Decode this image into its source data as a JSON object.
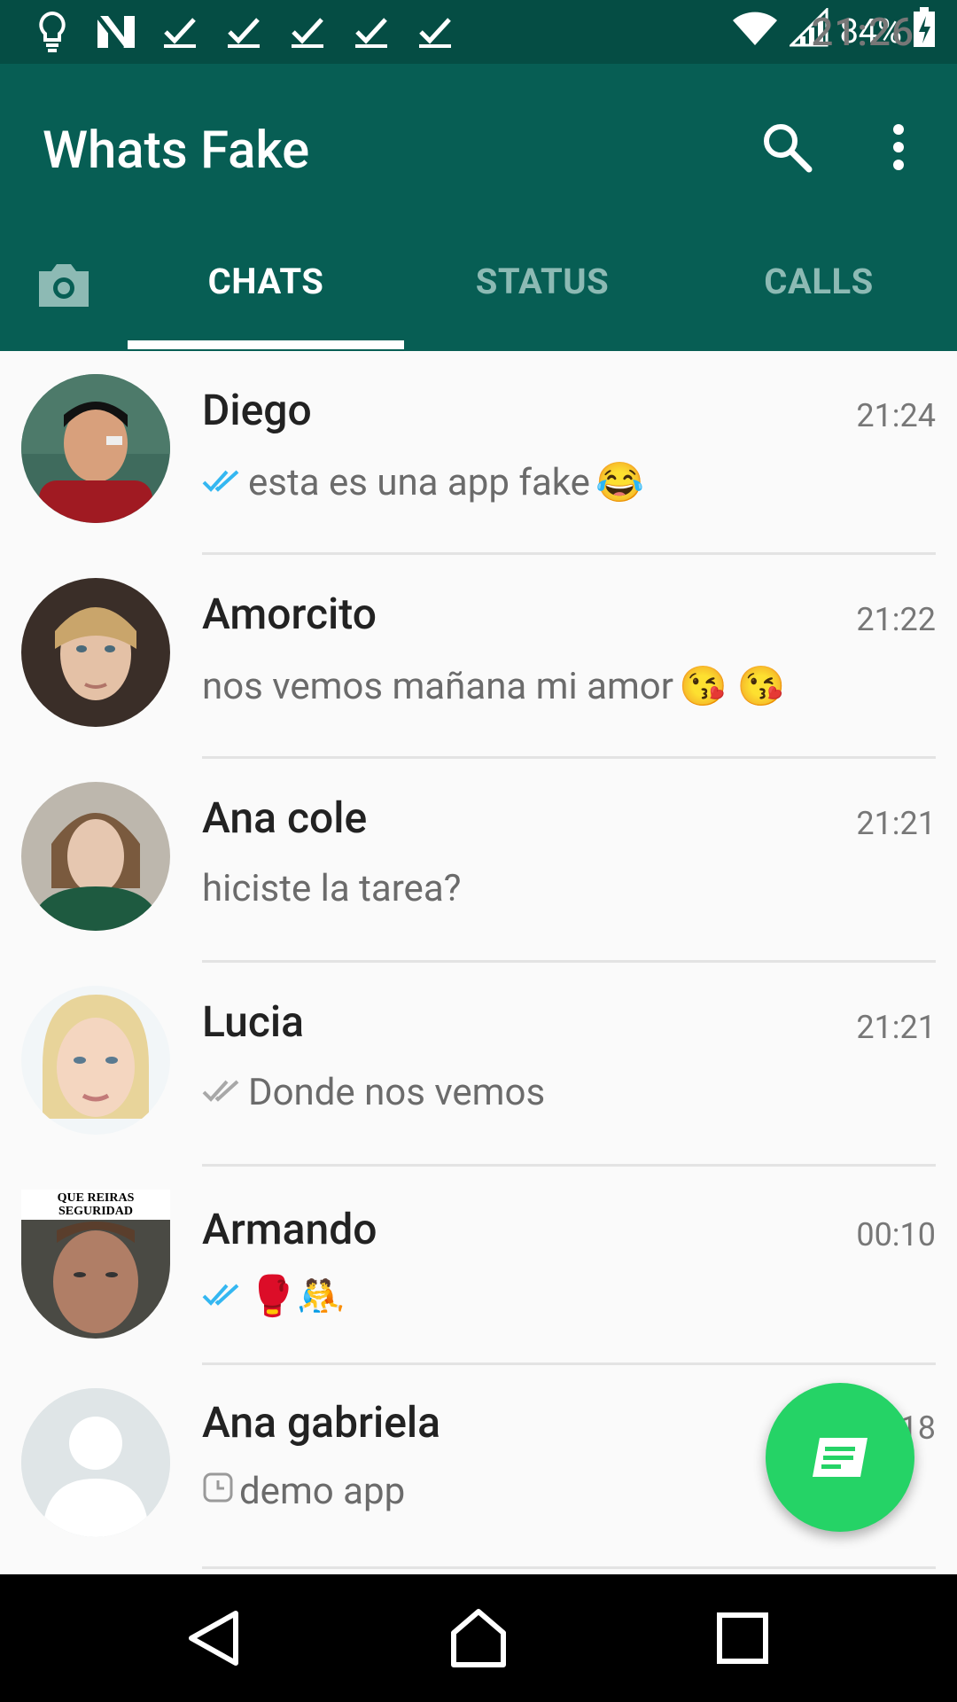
{
  "status_bar": {
    "battery": "84%",
    "time": "21:26",
    "left_icons": [
      "lightbulb-icon",
      "n-icon",
      "check-icon",
      "check-icon",
      "check-icon",
      "check-icon",
      "check-icon"
    ],
    "right_icons": [
      "wifi-icon",
      "signal-icon",
      "battery-charging-icon"
    ]
  },
  "app_bar": {
    "title": "Whats Fake",
    "actions": [
      "search-icon",
      "more-vert-icon"
    ]
  },
  "tabs": {
    "items": [
      {
        "label": "CHATS",
        "active": true
      },
      {
        "label": "STATUS",
        "active": false
      },
      {
        "label": "CALLS",
        "active": false
      }
    ]
  },
  "chats": [
    {
      "name": "Diego",
      "time": "21:24",
      "message": "esta es una app fake",
      "emoji": "😂",
      "status": "read"
    },
    {
      "name": "Amorcito",
      "time": "21:22",
      "message": "nos vemos mañana mi amor",
      "emoji": "😘 😘",
      "status": "none"
    },
    {
      "name": "Ana cole",
      "time": "21:21",
      "message": "hiciste la tarea?",
      "emoji": "",
      "status": "none"
    },
    {
      "name": "Lucia",
      "time": "21:21",
      "message": "Donde nos vemos",
      "emoji": "",
      "status": "delivered"
    },
    {
      "name": "Armando",
      "time": "00:10",
      "message": "",
      "emoji": "🥊🤼",
      "status": "read",
      "avatar_caption": "QUE REIRAS SEGURIDAD"
    },
    {
      "name": "Ana gabriela",
      "time": "18",
      "message": "demo app",
      "emoji": "",
      "status": "pending"
    }
  ],
  "colors": {
    "status_bar": "#054d44",
    "app_bar": "#075e54",
    "fab": "#25d366",
    "read_ticks": "#34b7f1"
  }
}
